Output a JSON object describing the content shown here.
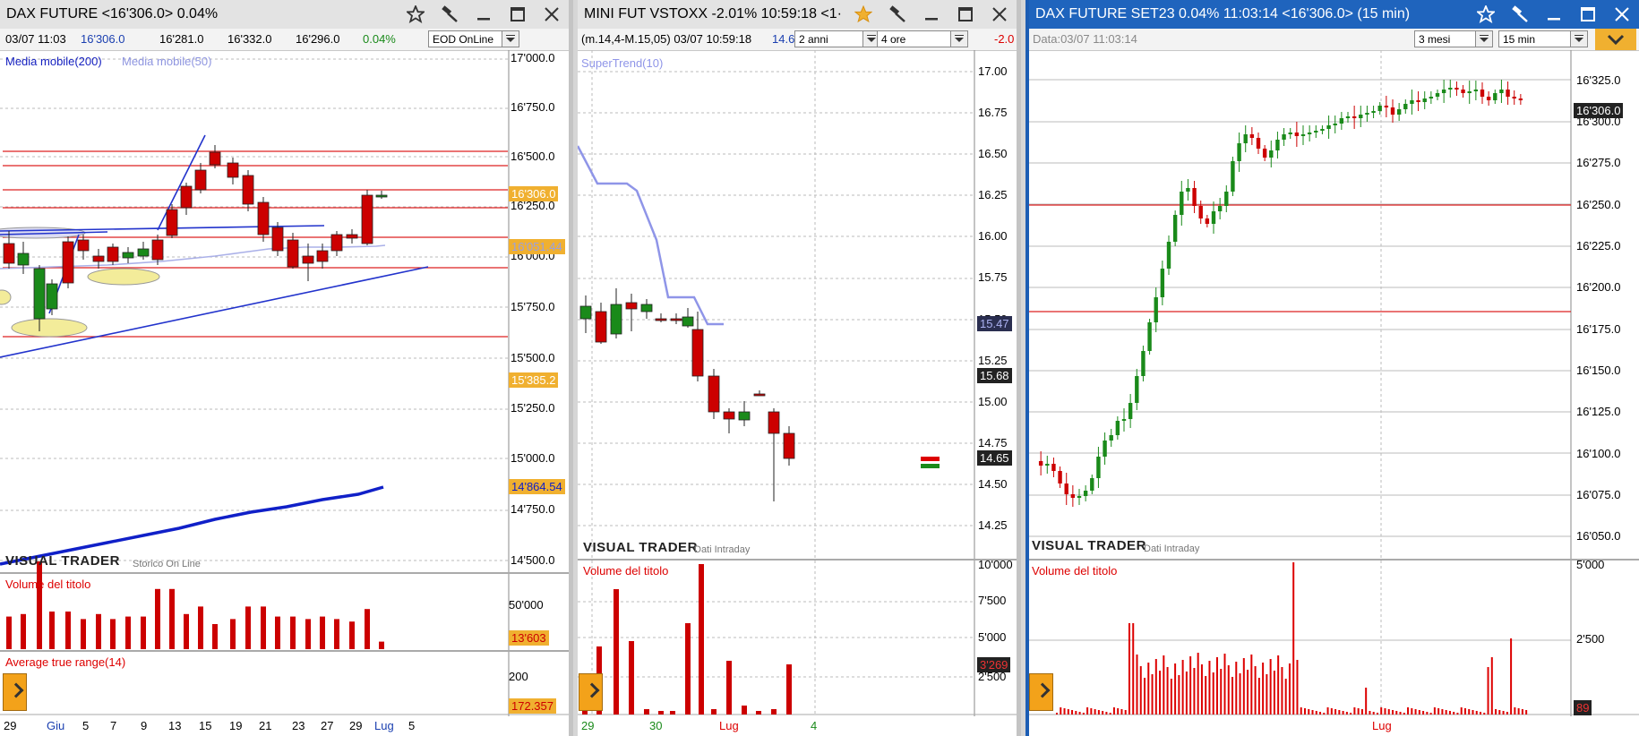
{
  "w1": {
    "title": "DAX FUTURE <16'306.0> 0.04%",
    "info": {
      "time": "03/07 11:03",
      "last": "16'306.0",
      "low": "16'281.0",
      "high": "16'332.0",
      "open": "16'296.0",
      "change": "0.04%"
    },
    "mode_select": "EOD OnLine",
    "legend_ma200": "Media mobile(200)",
    "legend_ma50": "Media mobile(50)",
    "price_axis": [
      "17'000.0",
      "16'750.0",
      "16'500.0",
      "16'250.0",
      "16'000.0",
      "15'750.0",
      "15'500.0",
      "15'250.0",
      "15'000.0",
      "14'750.0",
      "14'500.0"
    ],
    "badges": {
      "last": "16'306.0",
      "ma50": "16'051.44",
      "mid": "15'385.2",
      "ma200": "14'864.54"
    },
    "brand": "VISUAL TRADER",
    "brand_sub": "Storico On Line",
    "volume_label": "Volume del titolo",
    "volume_axis": "50'000",
    "volume_badge": "13'603",
    "atr_label": "Average true range(14)",
    "atr_axis": "200",
    "atr_badge": "172.357",
    "xaxis": [
      "29",
      "Giu",
      "5",
      "7",
      "9",
      "13",
      "15",
      "19",
      "21",
      "23",
      "27",
      "29",
      "Lug",
      "5"
    ]
  },
  "w2": {
    "title": "MINI FUT VSTOXX -2.01% 10:59:18 <1·",
    "info": {
      "prefix": "(m.14,4-M.15,05) 03/07 10:59:18",
      "last": "14.6",
      "change": "-2.0"
    },
    "range_select": "2 anni",
    "tf_select": "4 ore",
    "legend": "SuperTrend(10)",
    "price_axis": [
      "17.00",
      "16.75",
      "16.50",
      "16.25",
      "16.00",
      "15.75",
      "15.50",
      "15.25",
      "15.00",
      "14.75",
      "14.50",
      "14.25"
    ],
    "badges": {
      "st": "15.47",
      "mid": "15.68",
      "last": "14.65"
    },
    "brand": "VISUAL TRADER",
    "brand_sub": "Dati Intraday",
    "volume_label": "Volume del titolo",
    "volume_axis": [
      "10'000",
      "7'500",
      "5'000",
      "2'500"
    ],
    "volume_badge": "3'269",
    "xaxis": [
      "29",
      "30",
      "Lug",
      "4"
    ]
  },
  "w3": {
    "title": "DAX FUTURE SET23 0.04% 11:03:14 <16'306.0> (15 min)",
    "info": "Data:03/07 11:03:14",
    "range_select": "3 mesi",
    "tf_select": "15 min",
    "price_axis": [
      "16'325.0",
      "16'300.0",
      "16'275.0",
      "16'250.0",
      "16'225.0",
      "16'200.0",
      "16'175.0",
      "16'150.0",
      "16'125.0",
      "16'100.0",
      "16'075.0",
      "16'050.0"
    ],
    "badge_last": "16'306.0",
    "brand": "VISUAL TRADER",
    "brand_sub": "Dati Intraday",
    "volume_label": "Volume del titolo",
    "volume_axis": [
      "5'000",
      "2'500"
    ],
    "volume_badge": "89",
    "xaxis": [
      "Lug"
    ]
  },
  "colors": {
    "up": "#1a8a1a",
    "down": "#cc0000",
    "accent": "#f0b030",
    "blue_title": "#1f64bd"
  },
  "icons": [
    "star-icon",
    "hammer-icon",
    "minimize-icon",
    "maximize-icon",
    "close-icon",
    "play-icon",
    "chevron-down-icon"
  ]
}
